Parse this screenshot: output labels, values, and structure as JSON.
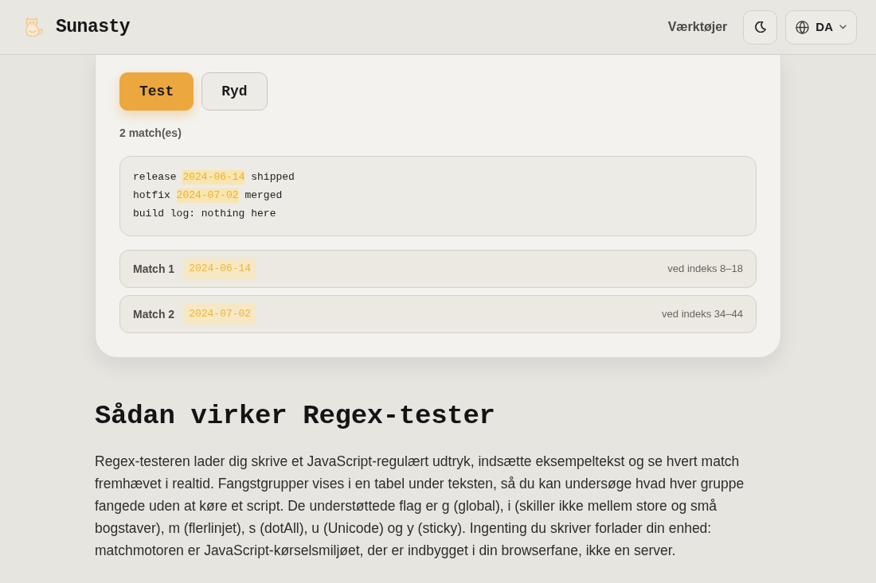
{
  "header": {
    "site_name": "Sunasty",
    "nav_link": "Værktøjer",
    "language": "DA"
  },
  "actions": [
    {
      "label": "Test",
      "kind": "primary"
    },
    {
      "label": "Ryd",
      "kind": "secondary"
    }
  ],
  "match_count": "2 match(es)",
  "sample_lines": [
    {
      "segments": [
        {
          "text": "release ",
          "highlighted": false
        },
        {
          "text": "2024-06-14",
          "highlighted": true
        },
        {
          "text": " shipped",
          "highlighted": false
        }
      ]
    },
    {
      "segments": [
        {
          "text": "hotfix ",
          "highlighted": false
        },
        {
          "text": "2024-07-02",
          "highlighted": true
        },
        {
          "text": " merged",
          "highlighted": false
        }
      ]
    },
    {
      "segments": [
        {
          "text": "build log: nothing here",
          "highlighted": false
        }
      ]
    }
  ],
  "matches": [
    {
      "label": "Match 1",
      "value": "2024-06-14",
      "position": "ved indeks 8–18"
    },
    {
      "label": "Match 2",
      "value": "2024-07-02",
      "position": "ved indeks 34–44"
    }
  ],
  "article": {
    "heading": "Sådan virker Regex-tester",
    "paragraphs": [
      "Regex-testeren lader dig skrive et JavaScript-regulært udtryk, indsætte eksempeltekst og se hvert match fremhævet i realtid. Fangstgrupper vises i en tabel under teksten, så du kan undersøge hvad hver gruppe fangede uden at køre et script. De understøttede flag er g (global), i (skiller ikke mellem store og små bogstaver), m (flerlinjet), s (dotAll), u (Unicode) og y (sticky). Ingenting du skriver forlader din enhed: matchmotoren er JavaScript-kørselsmiljøet, der er indbygget i din browserfane, ikke en server."
    ]
  }
}
